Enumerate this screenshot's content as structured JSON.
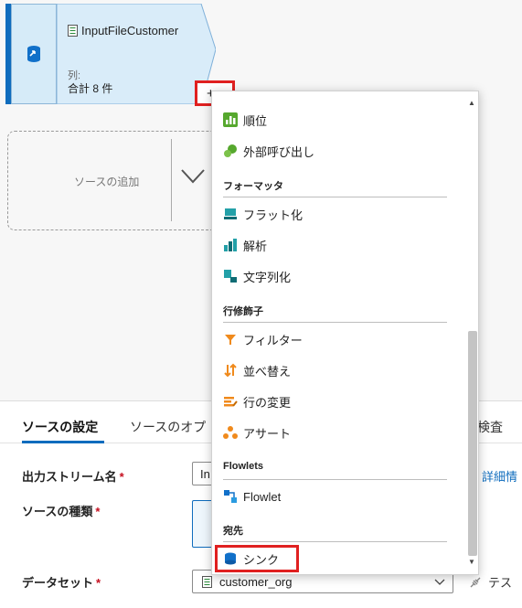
{
  "canvas": {
    "source_node": {
      "title": "InputFileCustomer",
      "columns_label": "列:",
      "columns_value": "合計 8 件",
      "add_button": "+"
    },
    "add_source": {
      "label": "ソースの追加"
    }
  },
  "menu": {
    "items_top": [
      {
        "label": "順位",
        "icon": "rank-icon"
      },
      {
        "label": "外部呼び出し",
        "icon": "external-call-icon"
      }
    ],
    "groups": [
      {
        "title": "フォーマッタ",
        "items": [
          {
            "label": "フラット化",
            "icon": "flatten-icon"
          },
          {
            "label": "解析",
            "icon": "parse-icon"
          },
          {
            "label": "文字列化",
            "icon": "stringify-icon"
          }
        ]
      },
      {
        "title": "行修飾子",
        "items": [
          {
            "label": "フィルター",
            "icon": "filter-icon"
          },
          {
            "label": "並べ替え",
            "icon": "sort-icon"
          },
          {
            "label": "行の変更",
            "icon": "alter-row-icon"
          },
          {
            "label": "アサート",
            "icon": "assert-icon"
          }
        ]
      },
      {
        "title": "Flowlets",
        "items": [
          {
            "label": "Flowlet",
            "icon": "flowlet-icon"
          }
        ]
      },
      {
        "title": "宛先",
        "items": [
          {
            "label": "シンク",
            "icon": "sink-icon"
          }
        ]
      }
    ]
  },
  "panel": {
    "tabs": [
      "ソースの設定",
      "ソースのオプ",
      "検査"
    ],
    "fields": {
      "output_stream": {
        "label": "出力ストリーム名",
        "required": "*",
        "value": "In"
      },
      "source_type": {
        "label": "ソースの種類",
        "required": "*"
      },
      "dataset": {
        "label": "データセット",
        "required": "*",
        "value": "customer_org"
      }
    },
    "details_link": "詳細情",
    "test_link": "テス"
  },
  "colors": {
    "accent": "#0f6cbd",
    "highlight": "#e02020"
  }
}
